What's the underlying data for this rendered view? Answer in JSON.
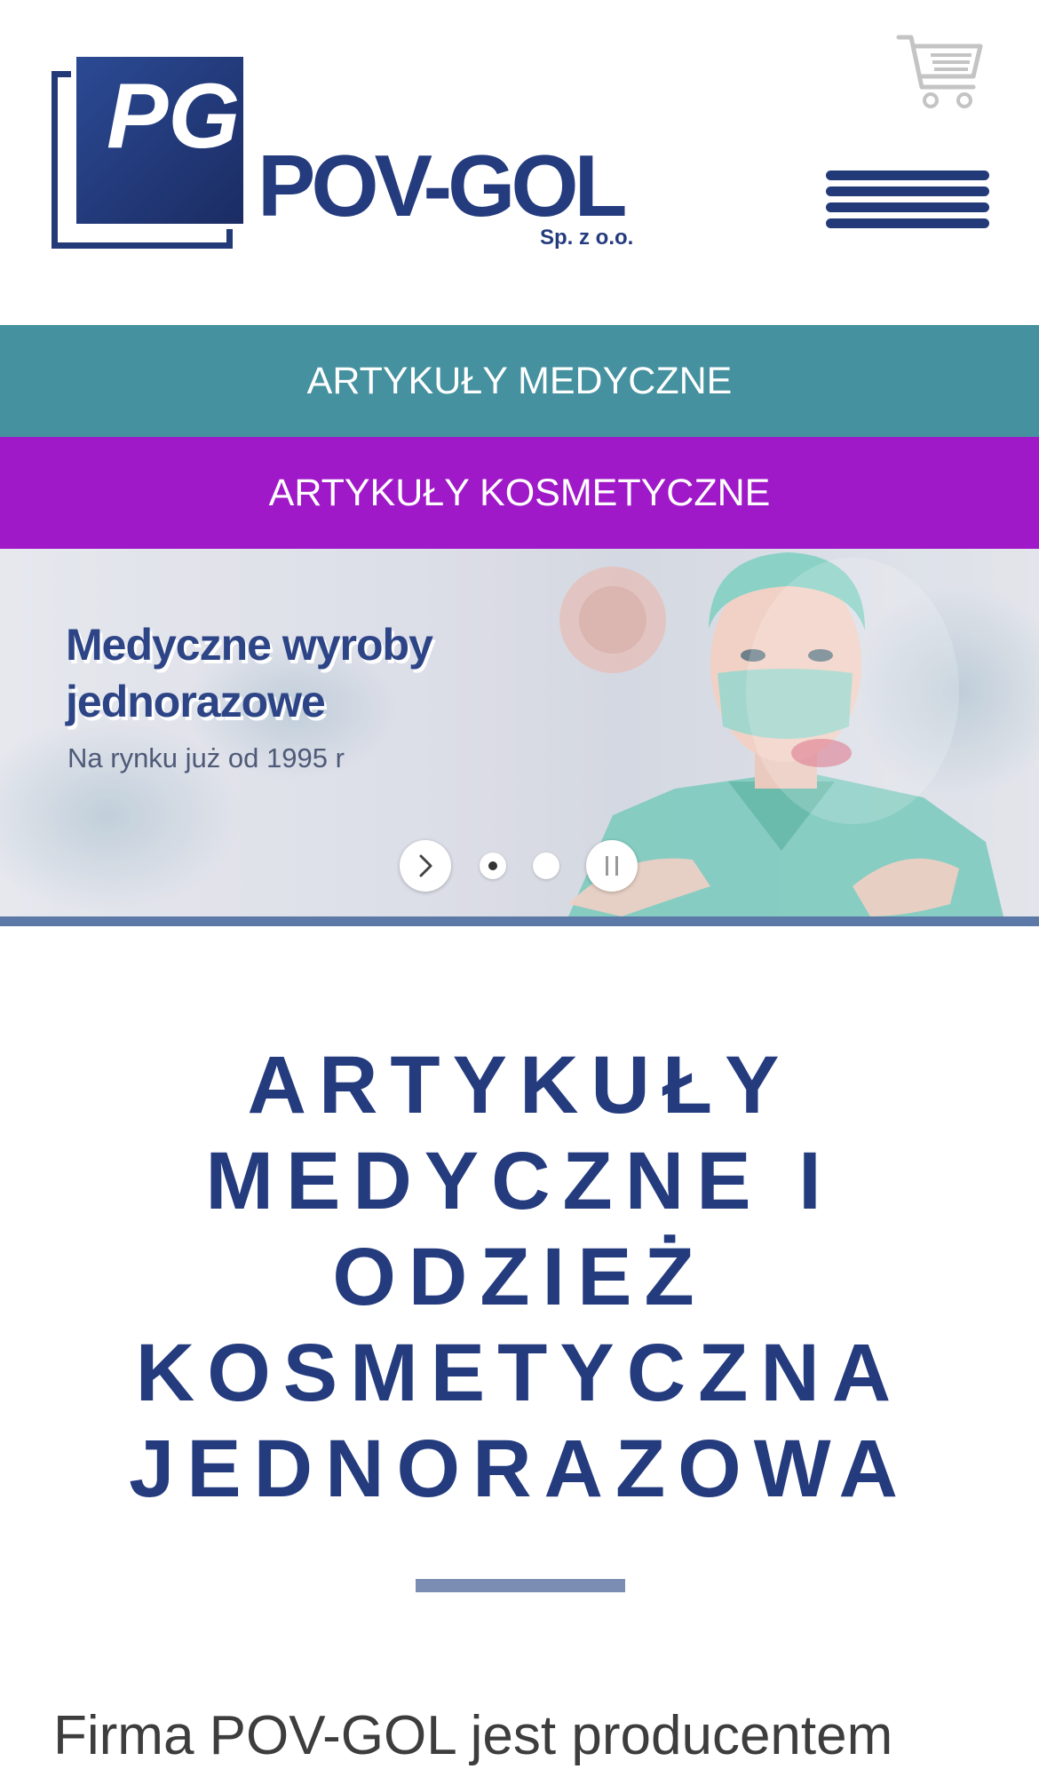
{
  "header": {
    "logo": {
      "monogram": "PG",
      "name": "POV-GOL",
      "suffix": "Sp. z o.o."
    },
    "cart_icon": "cart-icon",
    "menu_icon": "hamburger-menu-icon"
  },
  "nav": {
    "medical_label": "ARTYKUŁY MEDYCZNE",
    "cosmetic_label": "ARTYKUŁY KOSMETYCZNE"
  },
  "hero": {
    "title": "Medyczne wyroby jednorazowe",
    "subtitle": "Na rynku już od 1995 r",
    "next_icon": "chevron-right-icon",
    "pause_icon": "pause-icon",
    "active_slide": 1,
    "slide_count": 2
  },
  "main": {
    "heading": "ARTYKUŁY MEDYCZNE I ODZIEŻ KOSMETYCZNA JEDNORAZOWA",
    "intro_text": "Firma POV-GOL jest producentem"
  },
  "colors": {
    "brand_navy": "#243b7e",
    "nav_medical": "#45919f",
    "nav_cosmetic": "#a019c8",
    "divider": "#7b8db2"
  }
}
